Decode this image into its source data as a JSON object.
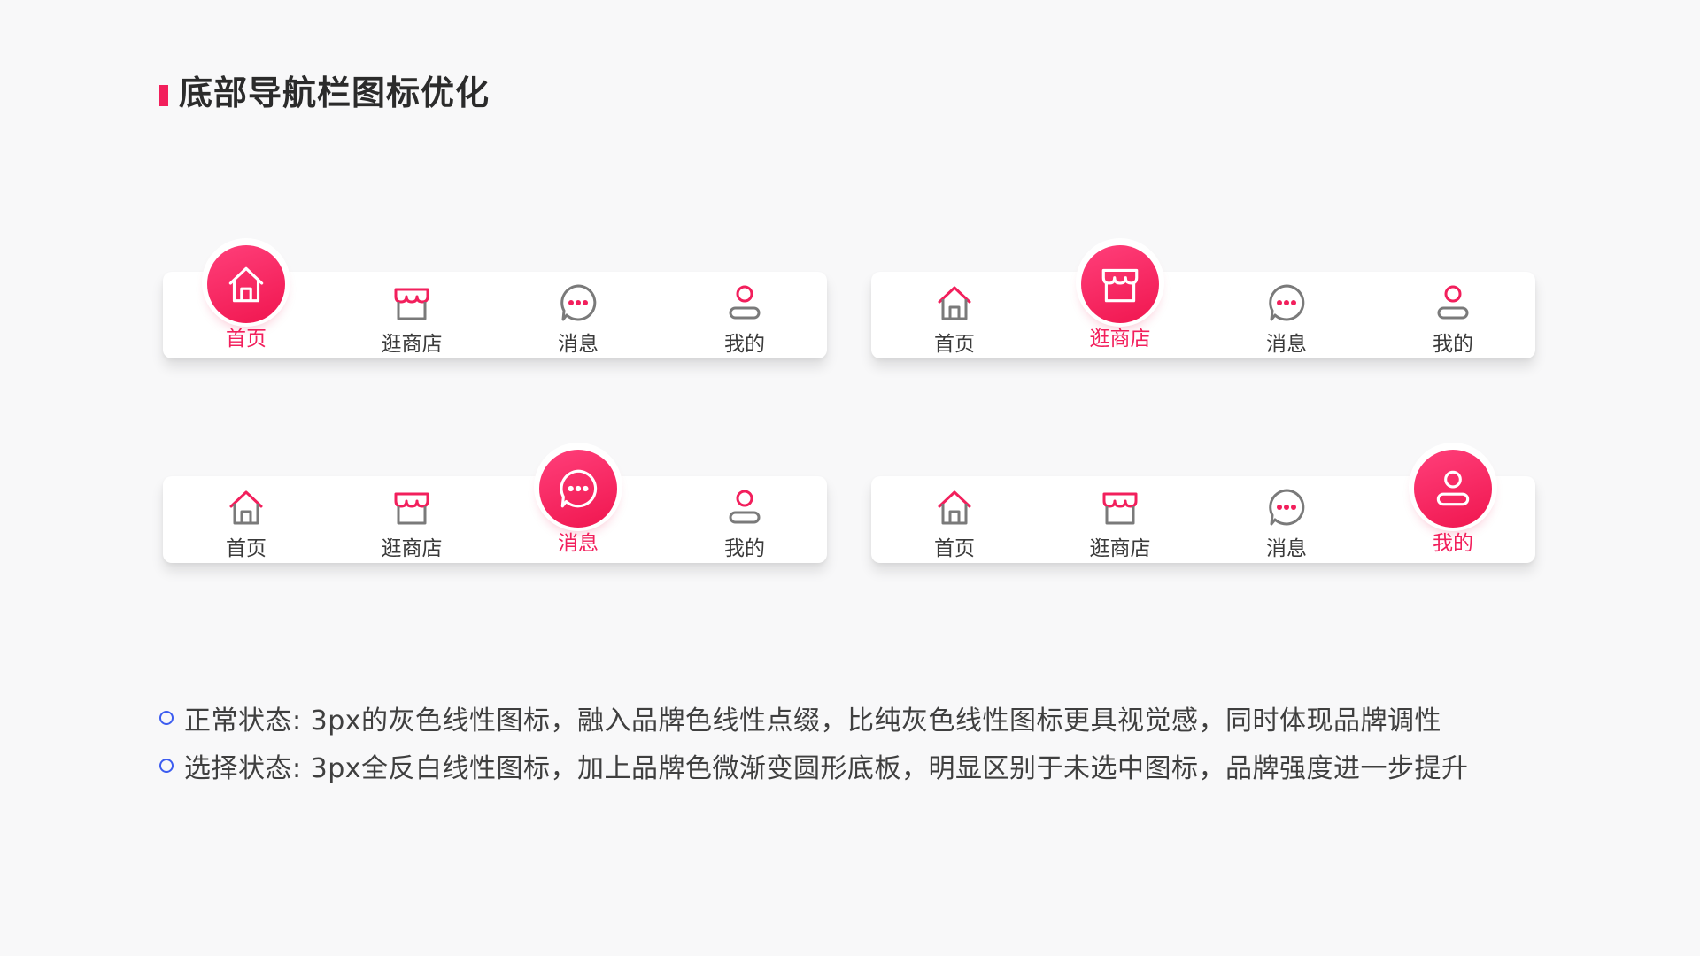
{
  "title": "底部导航栏图标优化",
  "colors": {
    "brand": "#f21f5c",
    "gray_line": "#7a7a7a",
    "bullet": "#3c5cf0"
  },
  "nav_labels": [
    "首页",
    "逛商店",
    "消息",
    "我的"
  ],
  "nav_icons": [
    "home-icon",
    "store-icon",
    "message-icon",
    "user-icon"
  ],
  "navbars": [
    {
      "active_index": 0,
      "labels": [
        "首页",
        "逛商店",
        "消息",
        "我的"
      ]
    },
    {
      "active_index": 1,
      "labels": [
        "首页",
        "逛商店",
        "消息",
        "我的"
      ]
    },
    {
      "active_index": 2,
      "labels": [
        "首页",
        "逛商店",
        "消息",
        "我的"
      ]
    },
    {
      "active_index": 3,
      "labels": [
        "首页",
        "逛商店",
        "消息",
        "我的"
      ]
    }
  ],
  "notes": [
    "正常状态: 3px的灰色线性图标，融入品牌色线性点缀，比纯灰色线性图标更具视觉感，同时体现品牌调性",
    "选择状态: 3px全反白线性图标，加上品牌色微渐变圆形底板，明显区别于未选中图标，品牌强度进一步提升"
  ]
}
